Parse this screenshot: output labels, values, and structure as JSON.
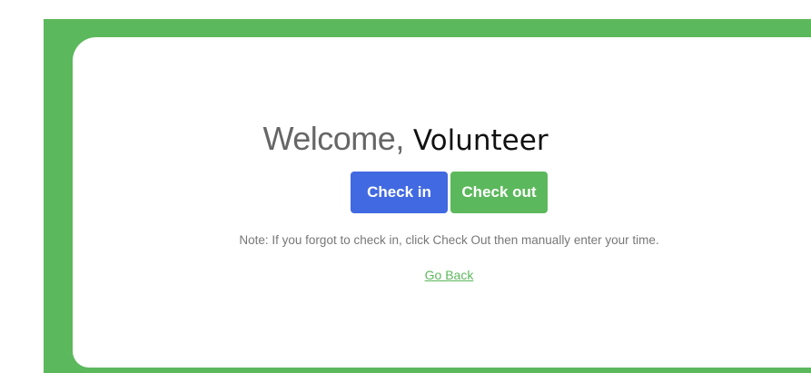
{
  "welcome": {
    "greeting": "Welcome,",
    "name": "Volunteer"
  },
  "actions": {
    "checkin_label": "Check in",
    "checkout_label": "Check out"
  },
  "note": "Note: If you forgot to check in, click Check Out then manually enter your time.",
  "back_link": "Go Back",
  "colors": {
    "frame": "#5cb85c",
    "checkin": "#4169e1",
    "checkout": "#5cb85c",
    "link": "#5cb85c"
  }
}
